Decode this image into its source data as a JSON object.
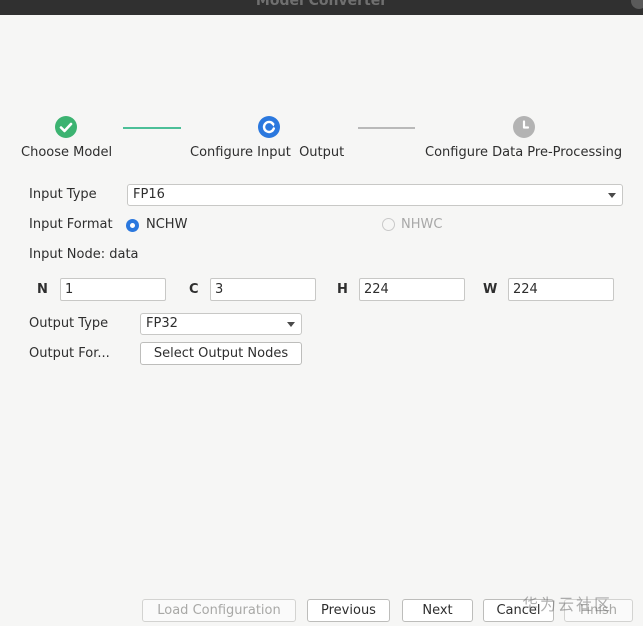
{
  "window": {
    "title": "Model Converter"
  },
  "stepper": {
    "steps": [
      {
        "label": "Choose Model",
        "state": "done",
        "icon": "check-icon"
      },
      {
        "label": "Configure Input  Output",
        "state": "active",
        "icon": "refresh-icon"
      },
      {
        "label": "Configure Data Pre-Processing",
        "state": "pending",
        "icon": "clock-icon"
      }
    ],
    "colors": {
      "done": "#3cb371",
      "active": "#2b78de",
      "pending": "#b3b3b3",
      "line_done": "#4cbf98",
      "line_pending": "#b9b9b9"
    }
  },
  "form": {
    "input_type_label": "Input Type",
    "input_type_value": "FP16",
    "input_format_label": "Input Format",
    "format_options": [
      {
        "label": "NCHW",
        "selected": true
      },
      {
        "label": "NHWC",
        "selected": false
      }
    ],
    "input_node_label": "Input Node: data",
    "dims": [
      {
        "label": "N",
        "value": "1"
      },
      {
        "label": "C",
        "value": "3"
      },
      {
        "label": "H",
        "value": "224"
      },
      {
        "label": "W",
        "value": "224"
      }
    ],
    "output_type_label": "Output Type",
    "output_type_value": "FP32",
    "output_format_label": "Output For...",
    "select_output_nodes_label": "Select Output Nodes"
  },
  "footer": {
    "load_configuration": "Load Configuration",
    "previous": "Previous",
    "next": "Next",
    "cancel": "Cancel",
    "finish": "Finish"
  },
  "watermark": "华为云社区"
}
